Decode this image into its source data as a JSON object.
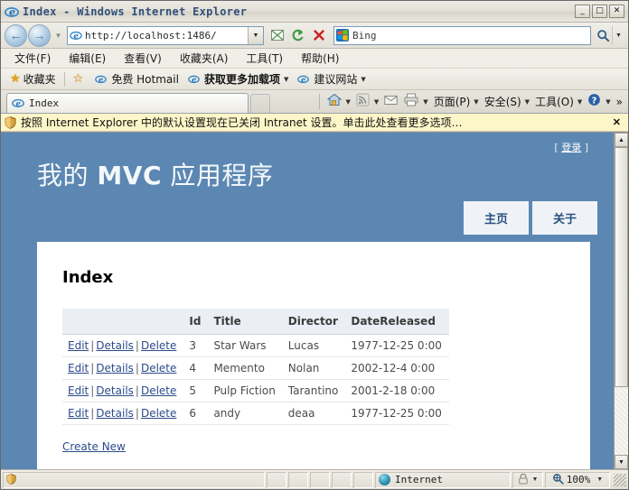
{
  "window": {
    "title": "Index - Windows Internet Explorer",
    "icon": "ie-logo-icon",
    "minimize_label": "_",
    "maximize_label": "□",
    "close_label": "✕"
  },
  "navbar": {
    "back_label": "←",
    "forward_label": "→",
    "history_caret": "▼",
    "address_value": "http://localhost:1486/",
    "address_placeholder": "",
    "address_dropdown": "▼",
    "compat_label": "▨",
    "refresh_label": "↺",
    "stop_label": "✕",
    "search_value": "Bing",
    "search_placeholder": "Bing",
    "search_go": "⚲",
    "search_caret": "▼"
  },
  "menubar": {
    "items": [
      {
        "label": "文件(F)",
        "name": "menu-file"
      },
      {
        "label": "编辑(E)",
        "name": "menu-edit"
      },
      {
        "label": "查看(V)",
        "name": "menu-view"
      },
      {
        "label": "收藏夹(A)",
        "name": "menu-favorites"
      },
      {
        "label": "工具(T)",
        "name": "menu-tools"
      },
      {
        "label": "帮助(H)",
        "name": "menu-help"
      }
    ]
  },
  "favbar": {
    "favorites_label": "收藏夹",
    "items": [
      {
        "label": "免费 Hotmail",
        "caret": "",
        "bold": false
      },
      {
        "label": "获取更多加载项",
        "caret": "▼",
        "bold": true
      },
      {
        "label": "建议网站",
        "caret": "▼",
        "bold": false
      }
    ]
  },
  "tabbar": {
    "tab_label": "Index",
    "commands": [
      {
        "label": "",
        "glyph": "⌂",
        "caret": "▼",
        "name": "home-icon"
      },
      {
        "label": "",
        "glyph": "◕",
        "caret": "▼",
        "name": "rss-icon"
      },
      {
        "label": "",
        "glyph": "✉",
        "caret": "",
        "name": "mail-icon"
      },
      {
        "label": "",
        "glyph": "⎙",
        "caret": "▼",
        "name": "print-icon"
      },
      {
        "label": "页面(P)",
        "glyph": "",
        "caret": "▼",
        "name": "page-menu"
      },
      {
        "label": "安全(S)",
        "glyph": "",
        "caret": "▼",
        "name": "safety-menu"
      },
      {
        "label": "工具(O)",
        "glyph": "",
        "caret": "▼",
        "name": "tools-menu"
      },
      {
        "label": "",
        "glyph": "❓",
        "caret": "▼",
        "name": "help-icon"
      },
      {
        "label": "»",
        "glyph": "",
        "caret": "",
        "name": "overflow-chevron-icon"
      }
    ]
  },
  "infobar": {
    "message": "按照 Internet Explorer 中的默认设置现在已关闭 Intranet 设置。单击此处查看更多选项…",
    "close_label": "✕"
  },
  "page": {
    "login_open": "[",
    "login_label": "登录",
    "login_close": "]",
    "site_title_part1": "我的 ",
    "site_title_strong": "MVC",
    "site_title_part2": " 应用程序",
    "nav_tabs": [
      {
        "label": "主页",
        "name": "nav-tab-home"
      },
      {
        "label": "关于",
        "name": "nav-tab-about"
      }
    ],
    "heading": "Index",
    "table": {
      "columns": [
        "",
        "Id",
        "Title",
        "Director",
        "DateReleased"
      ],
      "row_actions": [
        "Edit",
        "Details",
        "Delete"
      ],
      "action_separator": "|",
      "rows": [
        {
          "id": "3",
          "title": "Star Wars",
          "director": "Lucas",
          "date_released": "1977-12-25 0:00"
        },
        {
          "id": "4",
          "title": "Memento",
          "director": "Nolan",
          "date_released": "2002-12-4 0:00"
        },
        {
          "id": "5",
          "title": "Pulp Fiction",
          "director": "Tarantino",
          "date_released": "2001-2-18 0:00"
        },
        {
          "id": "6",
          "title": "andy",
          "director": "deaa",
          "date_released": "1977-12-25 0:00"
        }
      ]
    },
    "create_new_label": "Create New",
    "colors": {
      "header_blue": "#5c87b2",
      "nav_tab_bg": "#eff3f8",
      "nav_tab_text": "#2a5180",
      "link": "#2b4b8a",
      "table_header_bg": "#eceef5"
    }
  },
  "scrollbar": {
    "up_label": "▲",
    "down_label": "▼"
  },
  "statusbar": {
    "zone_label": "Internet",
    "zoom_label": "100%",
    "zoom_caret": "▼",
    "lock_caret": "▼",
    "status_text": ""
  }
}
